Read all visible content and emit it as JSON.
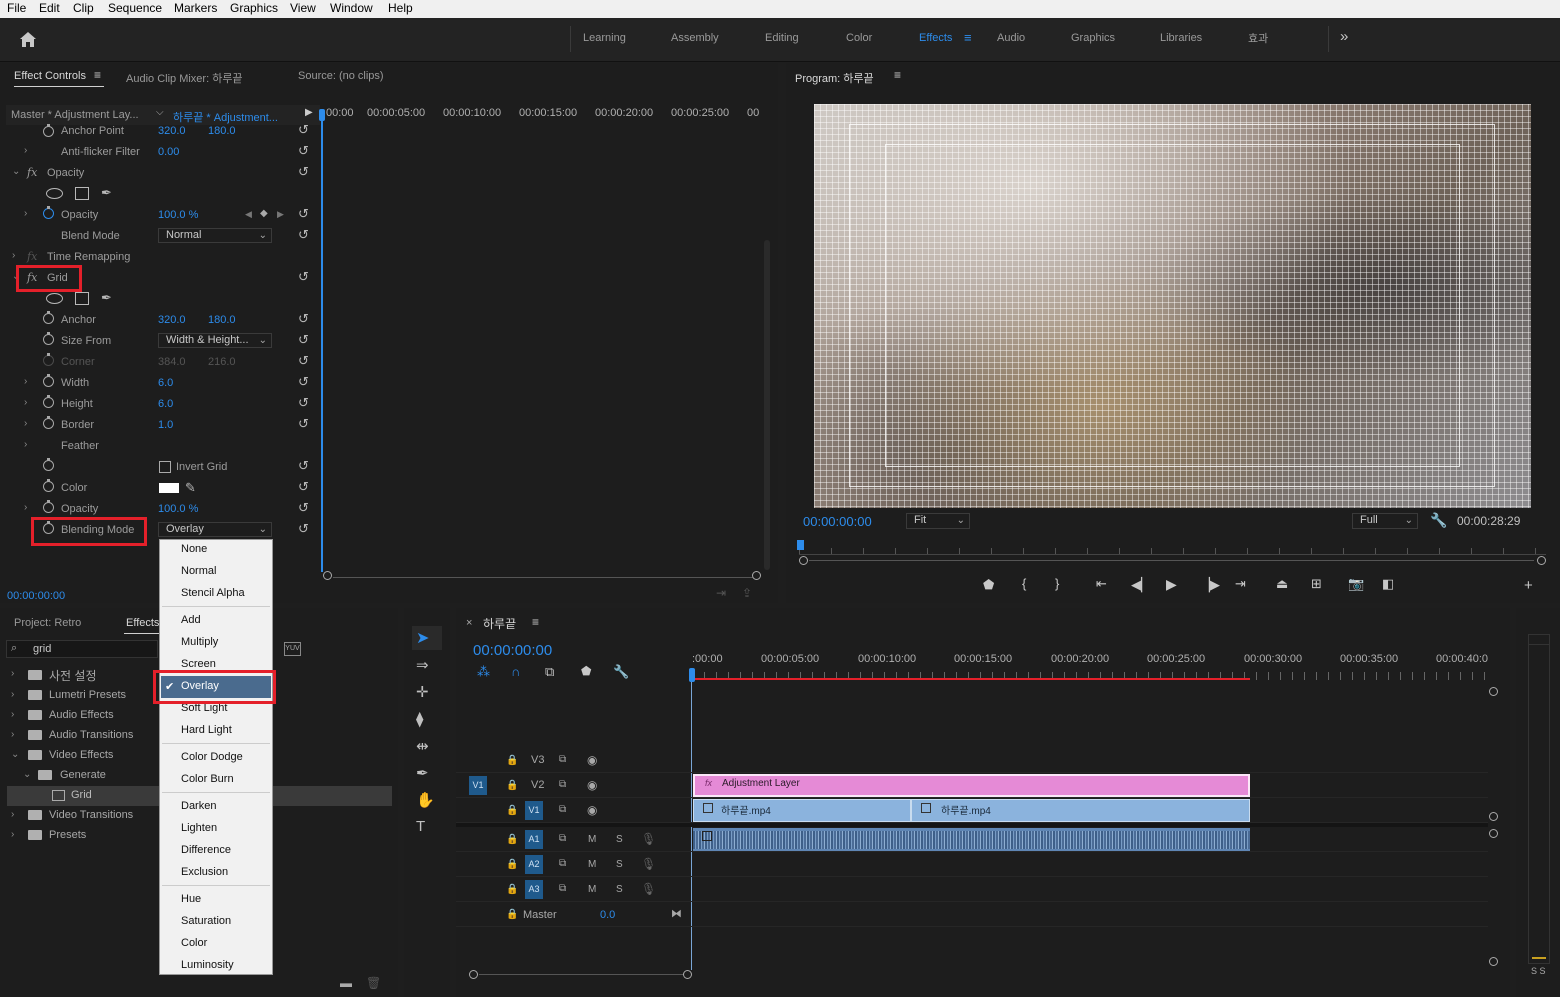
{
  "menubar": {
    "items": [
      "File",
      "Edit",
      "Clip",
      "Sequence",
      "Markers",
      "Graphics",
      "View",
      "Window",
      "Help"
    ]
  },
  "workspaces": {
    "items": [
      "Learning",
      "Assembly",
      "Editing",
      "Color",
      "Effects",
      "Audio",
      "Graphics",
      "Libraries",
      "효과"
    ],
    "active": "Effects",
    "more": "»"
  },
  "effect_controls": {
    "tabs": [
      "Effect Controls",
      "Audio Clip Mixer: 하루끝",
      "Source: (no clips)"
    ],
    "master": "Master * Adjustment Lay...",
    "clip": "하루끝 * Adjustment...",
    "ruler": [
      "00:00",
      "00:00:05:00",
      "00:00:10:00",
      "00:00:15:00",
      "00:00:20:00",
      "00:00:25:00",
      "00"
    ],
    "timecode": "00:00:00:00",
    "rows": {
      "anchor_point": {
        "label": "Anchor Point",
        "v1": "320.0",
        "v2": "180.0"
      },
      "anti_flicker": {
        "label": "Anti-flicker Filter",
        "v1": "0.00"
      },
      "opacity_section": "Opacity",
      "opacity": {
        "label": "Opacity",
        "v1": "100.0 %"
      },
      "blend_mode": {
        "label": "Blend Mode",
        "value": "Normal"
      },
      "time_remapping": "Time Remapping",
      "grid_section": "Grid",
      "anchor": {
        "label": "Anchor",
        "v1": "320.0",
        "v2": "180.0"
      },
      "size_from": {
        "label": "Size From",
        "value": "Width & Height..."
      },
      "corner": {
        "label": "Corner",
        "v1": "384.0",
        "v2": "216.0"
      },
      "width": {
        "label": "Width",
        "v1": "6.0"
      },
      "height": {
        "label": "Height",
        "v1": "6.0"
      },
      "border": {
        "label": "Border",
        "v1": "1.0"
      },
      "feather": {
        "label": "Feather"
      },
      "invert_grid": {
        "label": "Invert Grid"
      },
      "color": {
        "label": "Color"
      },
      "grid_opacity": {
        "label": "Opacity",
        "v1": "100.0 %"
      },
      "blending_mode": {
        "label": "Blending Mode",
        "value": "Overlay"
      }
    }
  },
  "blend_menu": {
    "groups": [
      [
        "None",
        "Normal",
        "Stencil Alpha"
      ],
      [
        "Add",
        "Multiply",
        "Screen",
        "Overlay",
        "Soft Light",
        "Hard Light"
      ],
      [
        "Color Dodge",
        "Color Burn"
      ],
      [
        "Darken",
        "Lighten",
        "Difference",
        "Exclusion"
      ],
      [
        "Hue",
        "Saturation",
        "Color",
        "Luminosity"
      ]
    ],
    "selected": "Overlay"
  },
  "program": {
    "title": "Program: 하루끝",
    "timecode": "00:00:00:00",
    "fit": "Fit",
    "quality": "Full",
    "duration": "00:00:28:29"
  },
  "project": {
    "tabs": [
      "Project: Retro",
      "Effects"
    ],
    "search": "grid",
    "tree": [
      {
        "label": "사전 설정",
        "indent": 0,
        "open": false
      },
      {
        "label": "Lumetri Presets",
        "indent": 0,
        "open": false
      },
      {
        "label": "Audio Effects",
        "indent": 0,
        "open": false
      },
      {
        "label": "Audio Transitions",
        "indent": 0,
        "open": false
      },
      {
        "label": "Video Effects",
        "indent": 0,
        "open": true
      },
      {
        "label": "Generate",
        "indent": 1,
        "open": true
      },
      {
        "label": "Grid",
        "indent": 2,
        "open": false
      },
      {
        "label": "Video Transitions",
        "indent": 0,
        "open": false
      },
      {
        "label": "Presets",
        "indent": 0,
        "open": false
      }
    ]
  },
  "timeline": {
    "title": "하루끝",
    "timecode": "00:00:00:00",
    "ruler": [
      ":00:00",
      "00:00:05:00",
      "00:00:10:00",
      "00:00:15:00",
      "00:00:20:00",
      "00:00:25:00",
      "00:00:30:00",
      "00:00:35:00",
      "00:00:40:0"
    ],
    "tracks": [
      "V3",
      "V2",
      "V1",
      "A1",
      "A2",
      "A3"
    ],
    "master_label": "Master",
    "master_value": "0.0",
    "source_patch": "V1",
    "clips": {
      "adjustment": "Adjustment Layer",
      "video1": "하루끝.mp4",
      "video2": "하루끝.mp4"
    },
    "m": "M",
    "s": "S"
  },
  "audio_meter": {
    "labels": "S S"
  },
  "colors": {
    "accent_blue": "#2d8ceb",
    "highlight_red": "#e4202a",
    "adjustment_clip": "#e58ad6",
    "video_clip": "#8bb3dd",
    "audio_clip": "#5f86b4"
  }
}
